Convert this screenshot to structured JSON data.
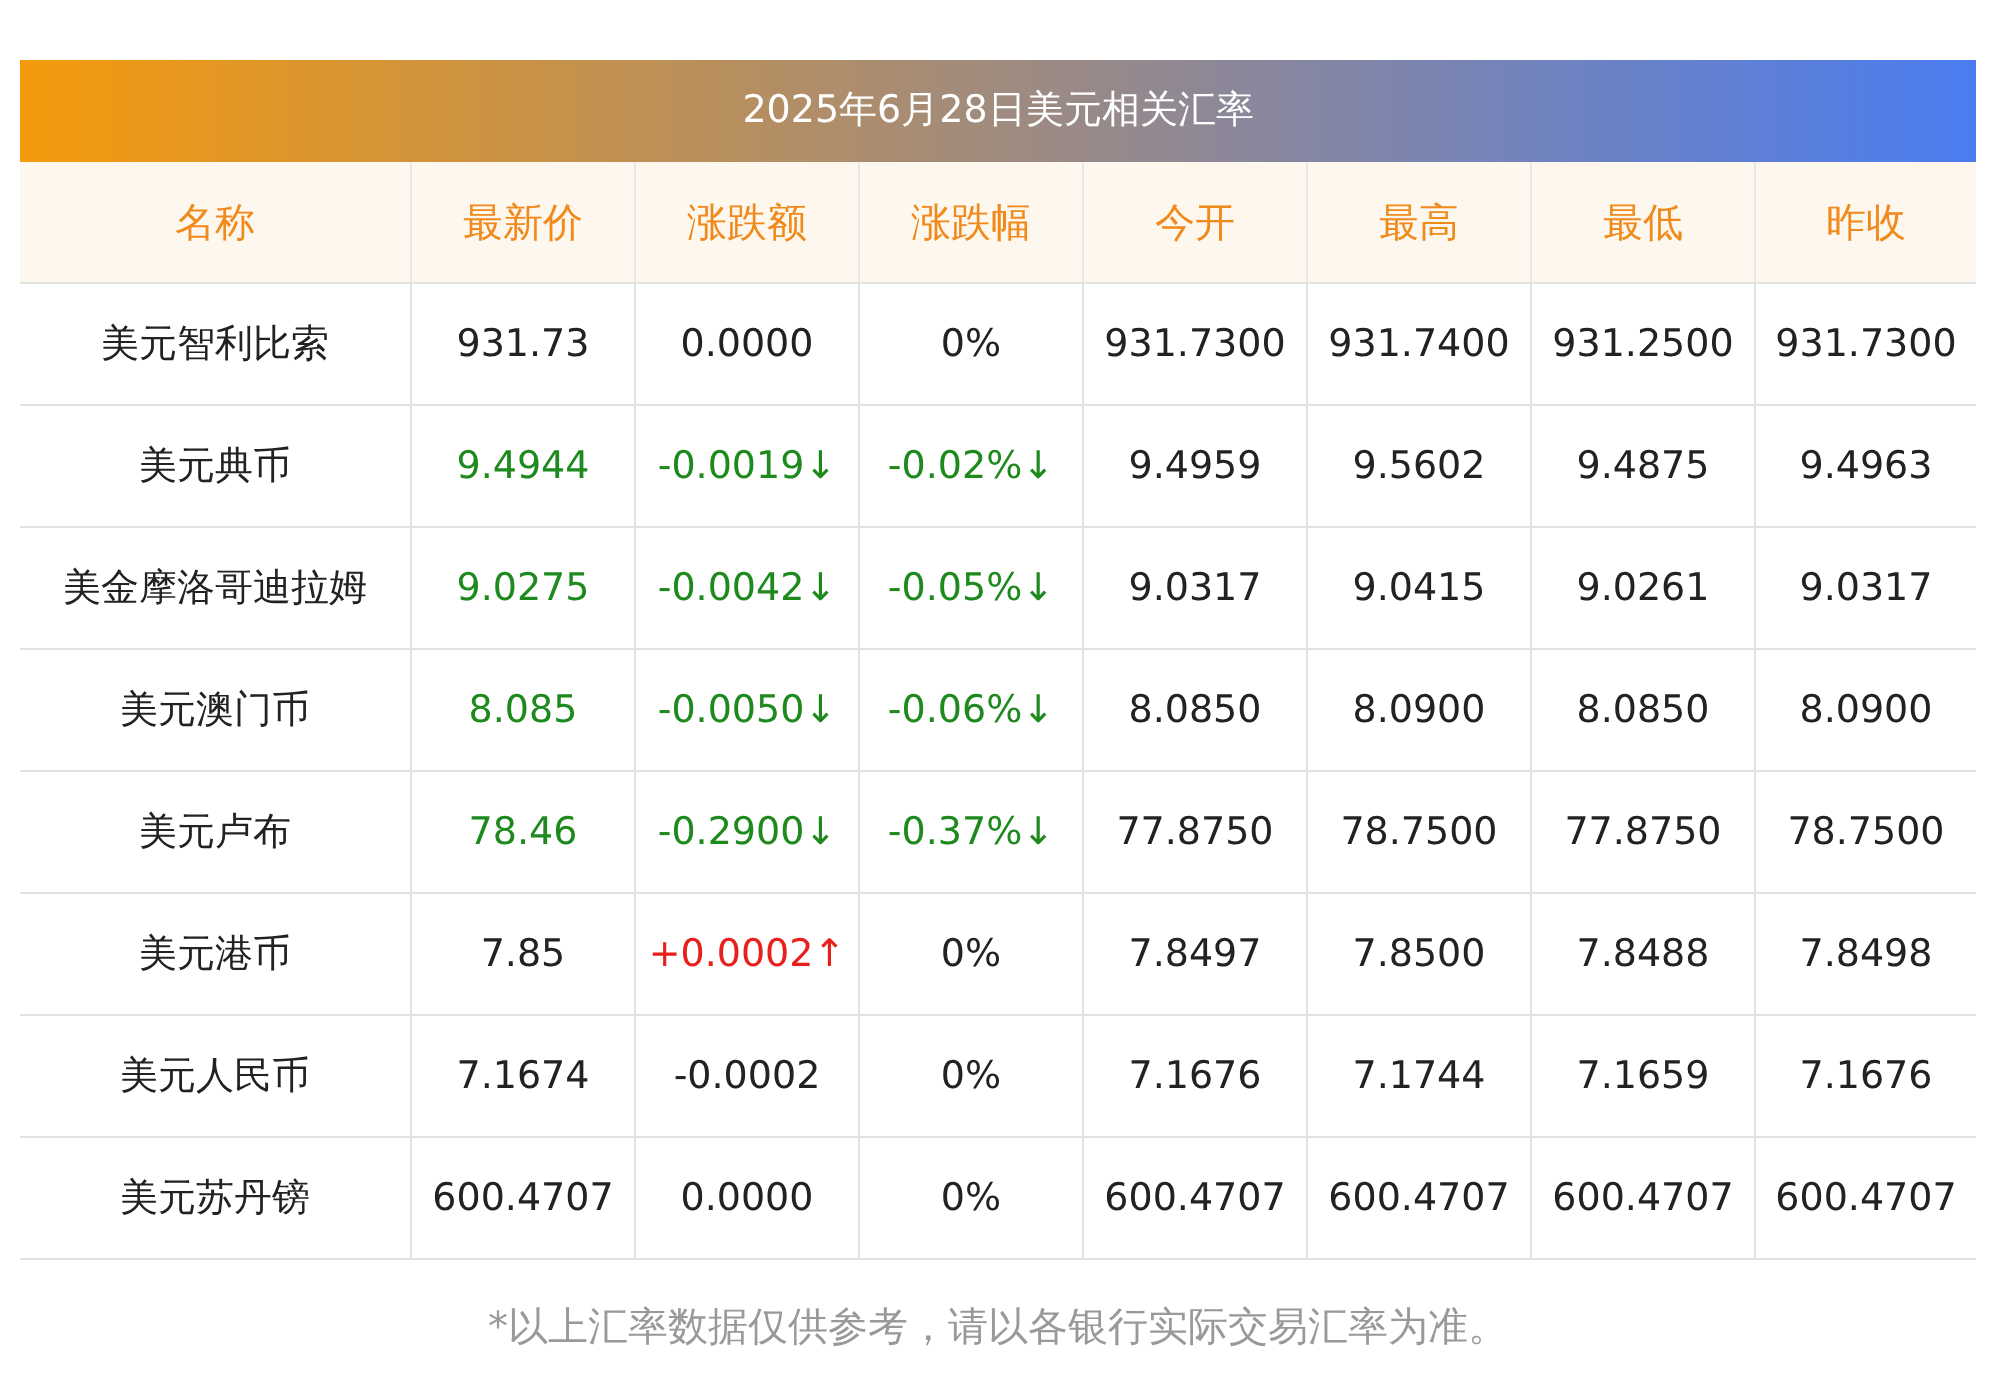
{
  "title": "2025年6月28日美元相关汇率",
  "columns": [
    "名称",
    "最新价",
    "涨跌额",
    "涨跌幅",
    "今开",
    "最高",
    "最低",
    "昨收"
  ],
  "rows": [
    {
      "cells": [
        {
          "text": "美元智利比索",
          "kind": "plain"
        },
        {
          "text": "931.73",
          "kind": "plain"
        },
        {
          "text": "0.0000",
          "kind": "plain"
        },
        {
          "text": "0%",
          "kind": "plain"
        },
        {
          "text": "931.7300",
          "kind": "plain"
        },
        {
          "text": "931.7400",
          "kind": "plain"
        },
        {
          "text": "931.2500",
          "kind": "plain"
        },
        {
          "text": "931.7300",
          "kind": "plain"
        }
      ]
    },
    {
      "cells": [
        {
          "text": "美元典币",
          "kind": "plain"
        },
        {
          "text": "9.4944",
          "kind": "down"
        },
        {
          "text": "-0.0019↓",
          "kind": "down"
        },
        {
          "text": "-0.02%↓",
          "kind": "down"
        },
        {
          "text": "9.4959",
          "kind": "plain"
        },
        {
          "text": "9.5602",
          "kind": "plain"
        },
        {
          "text": "9.4875",
          "kind": "plain"
        },
        {
          "text": "9.4963",
          "kind": "plain"
        }
      ]
    },
    {
      "cells": [
        {
          "text": "美金摩洛哥迪拉姆",
          "kind": "plain"
        },
        {
          "text": "9.0275",
          "kind": "down"
        },
        {
          "text": "-0.0042↓",
          "kind": "down"
        },
        {
          "text": "-0.05%↓",
          "kind": "down"
        },
        {
          "text": "9.0317",
          "kind": "plain"
        },
        {
          "text": "9.0415",
          "kind": "plain"
        },
        {
          "text": "9.0261",
          "kind": "plain"
        },
        {
          "text": "9.0317",
          "kind": "plain"
        }
      ]
    },
    {
      "cells": [
        {
          "text": "美元澳门币",
          "kind": "plain"
        },
        {
          "text": "8.085",
          "kind": "down"
        },
        {
          "text": "-0.0050↓",
          "kind": "down"
        },
        {
          "text": "-0.06%↓",
          "kind": "down"
        },
        {
          "text": "8.0850",
          "kind": "plain"
        },
        {
          "text": "8.0900",
          "kind": "plain"
        },
        {
          "text": "8.0850",
          "kind": "plain"
        },
        {
          "text": "8.0900",
          "kind": "plain"
        }
      ]
    },
    {
      "cells": [
        {
          "text": "美元卢布",
          "kind": "plain"
        },
        {
          "text": "78.46",
          "kind": "down"
        },
        {
          "text": "-0.2900↓",
          "kind": "down"
        },
        {
          "text": "-0.37%↓",
          "kind": "down"
        },
        {
          "text": "77.8750",
          "kind": "plain"
        },
        {
          "text": "78.7500",
          "kind": "plain"
        },
        {
          "text": "77.8750",
          "kind": "plain"
        },
        {
          "text": "78.7500",
          "kind": "plain"
        }
      ]
    },
    {
      "cells": [
        {
          "text": "美元港币",
          "kind": "plain"
        },
        {
          "text": "7.85",
          "kind": "plain"
        },
        {
          "text": "+0.0002↑",
          "kind": "up"
        },
        {
          "text": "0%",
          "kind": "plain"
        },
        {
          "text": "7.8497",
          "kind": "plain"
        },
        {
          "text": "7.8500",
          "kind": "plain"
        },
        {
          "text": "7.8488",
          "kind": "plain"
        },
        {
          "text": "7.8498",
          "kind": "plain"
        }
      ]
    },
    {
      "cells": [
        {
          "text": "美元人民币",
          "kind": "plain"
        },
        {
          "text": "7.1674",
          "kind": "plain"
        },
        {
          "text": "-0.0002",
          "kind": "plain"
        },
        {
          "text": "0%",
          "kind": "plain"
        },
        {
          "text": "7.1676",
          "kind": "plain"
        },
        {
          "text": "7.1744",
          "kind": "plain"
        },
        {
          "text": "7.1659",
          "kind": "plain"
        },
        {
          "text": "7.1676",
          "kind": "plain"
        }
      ]
    },
    {
      "cells": [
        {
          "text": "美元苏丹镑",
          "kind": "plain"
        },
        {
          "text": "600.4707",
          "kind": "plain"
        },
        {
          "text": "0.0000",
          "kind": "plain"
        },
        {
          "text": "0%",
          "kind": "plain"
        },
        {
          "text": "600.4707",
          "kind": "plain"
        },
        {
          "text": "600.4707",
          "kind": "plain"
        },
        {
          "text": "600.4707",
          "kind": "plain"
        },
        {
          "text": "600.4707",
          "kind": "plain"
        }
      ]
    }
  ],
  "footnote": "*以上汇率数据仅供参考，请以各银行实际交易汇率为准。"
}
